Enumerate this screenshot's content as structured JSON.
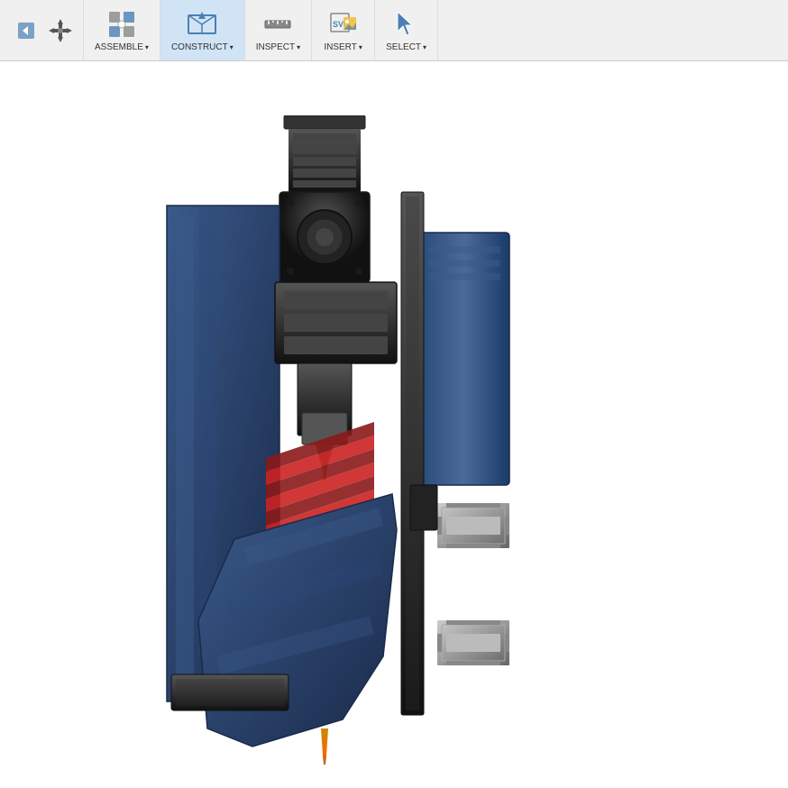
{
  "toolbar": {
    "items": [
      {
        "id": "assemble",
        "label": "ASSEMBLE",
        "has_arrow": true
      },
      {
        "id": "construct",
        "label": "CONSTRUCT",
        "has_arrow": true,
        "active": true
      },
      {
        "id": "inspect",
        "label": "INSPECT",
        "has_arrow": true
      },
      {
        "id": "insert",
        "label": "INSERT",
        "has_arrow": true
      },
      {
        "id": "select",
        "label": "SELECT",
        "has_arrow": true
      }
    ]
  },
  "canvas": {
    "background": "#ffffff"
  }
}
